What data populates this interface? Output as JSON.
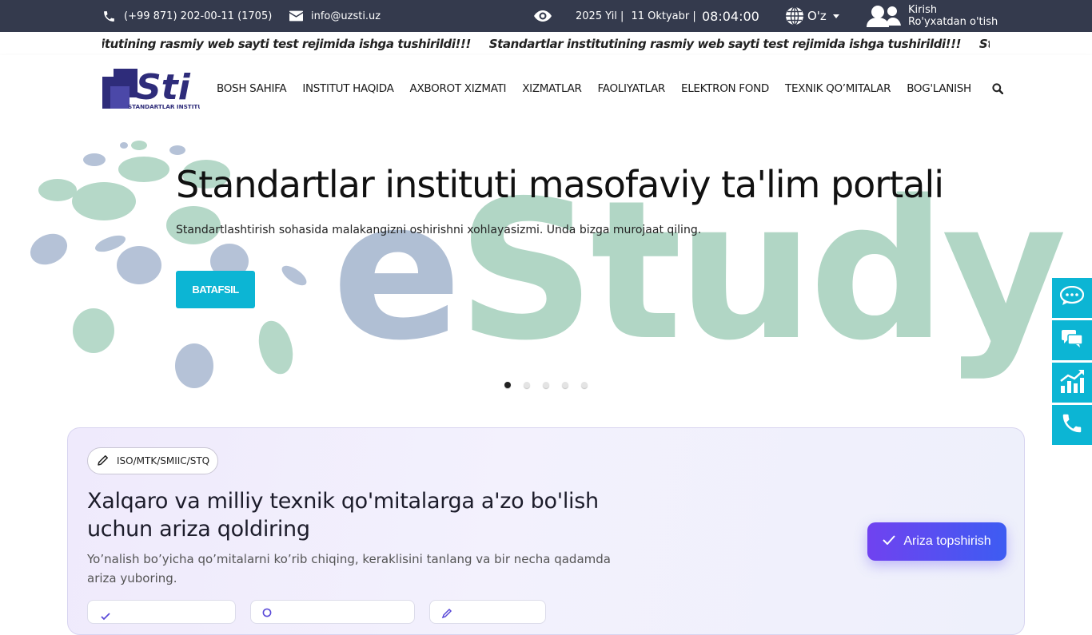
{
  "topbar": {
    "phone": "(+99 871) 202-00-11 (1705)",
    "email": "info@uzsti.uz",
    "year": "2025 Yil |",
    "date": "11 Oktyabr |",
    "time": "08:04:00",
    "language": "O'z",
    "login": "Kirish",
    "register": "Ro'yxatdan o'tish"
  },
  "announcement": {
    "text1": "r institutining rasmiy web sayti test rejimida ishga tushirildi!!!",
    "text2": "Standartlar institutining rasmiy web sayti test rejimida ishga tushirildi!!!",
    "text3": "Standartlar institutini"
  },
  "logo": {
    "text": "Sti",
    "caption": "STANDARTLAR INSTITUTI"
  },
  "nav": {
    "items": [
      "BOSH SAHIFA",
      "INSTITUT HAQIDA",
      "AXBOROT XIZMATI",
      "XIZMATLAR",
      "FAOLIYATLAR",
      "ELEKTRON FOND",
      "TEXNIK QO’MITALAR",
      "BOG'LANISH"
    ]
  },
  "hero": {
    "title": "Standartlar instituti masofaviy ta'lim portali",
    "subtitle": "Standartlashtirish sohasida malakangizni oshirishni xohlayasizmi. Unda bizga murojaat qiling.",
    "button": "BATAFSIL",
    "background_word": "eStudy",
    "slide_count": 5,
    "active_slide": 1,
    "colors": {
      "blue": "#a8b8d0",
      "green": "#a9d2bf",
      "accent": "#0cb5d4"
    }
  },
  "application": {
    "chip": "ISO/MTK/SMIIC/STQ",
    "title": "Xalqaro va milliy texnik qo'mitalarga a'zo bo'lish uchun ariza qoldiring",
    "description": "Yo’nalish bo’yicha qo’mitalarni ko’rib chiqing, keraklisini tanlang va bir necha qadamda ariza yuboring.",
    "submit": "Ariza topshirish"
  }
}
